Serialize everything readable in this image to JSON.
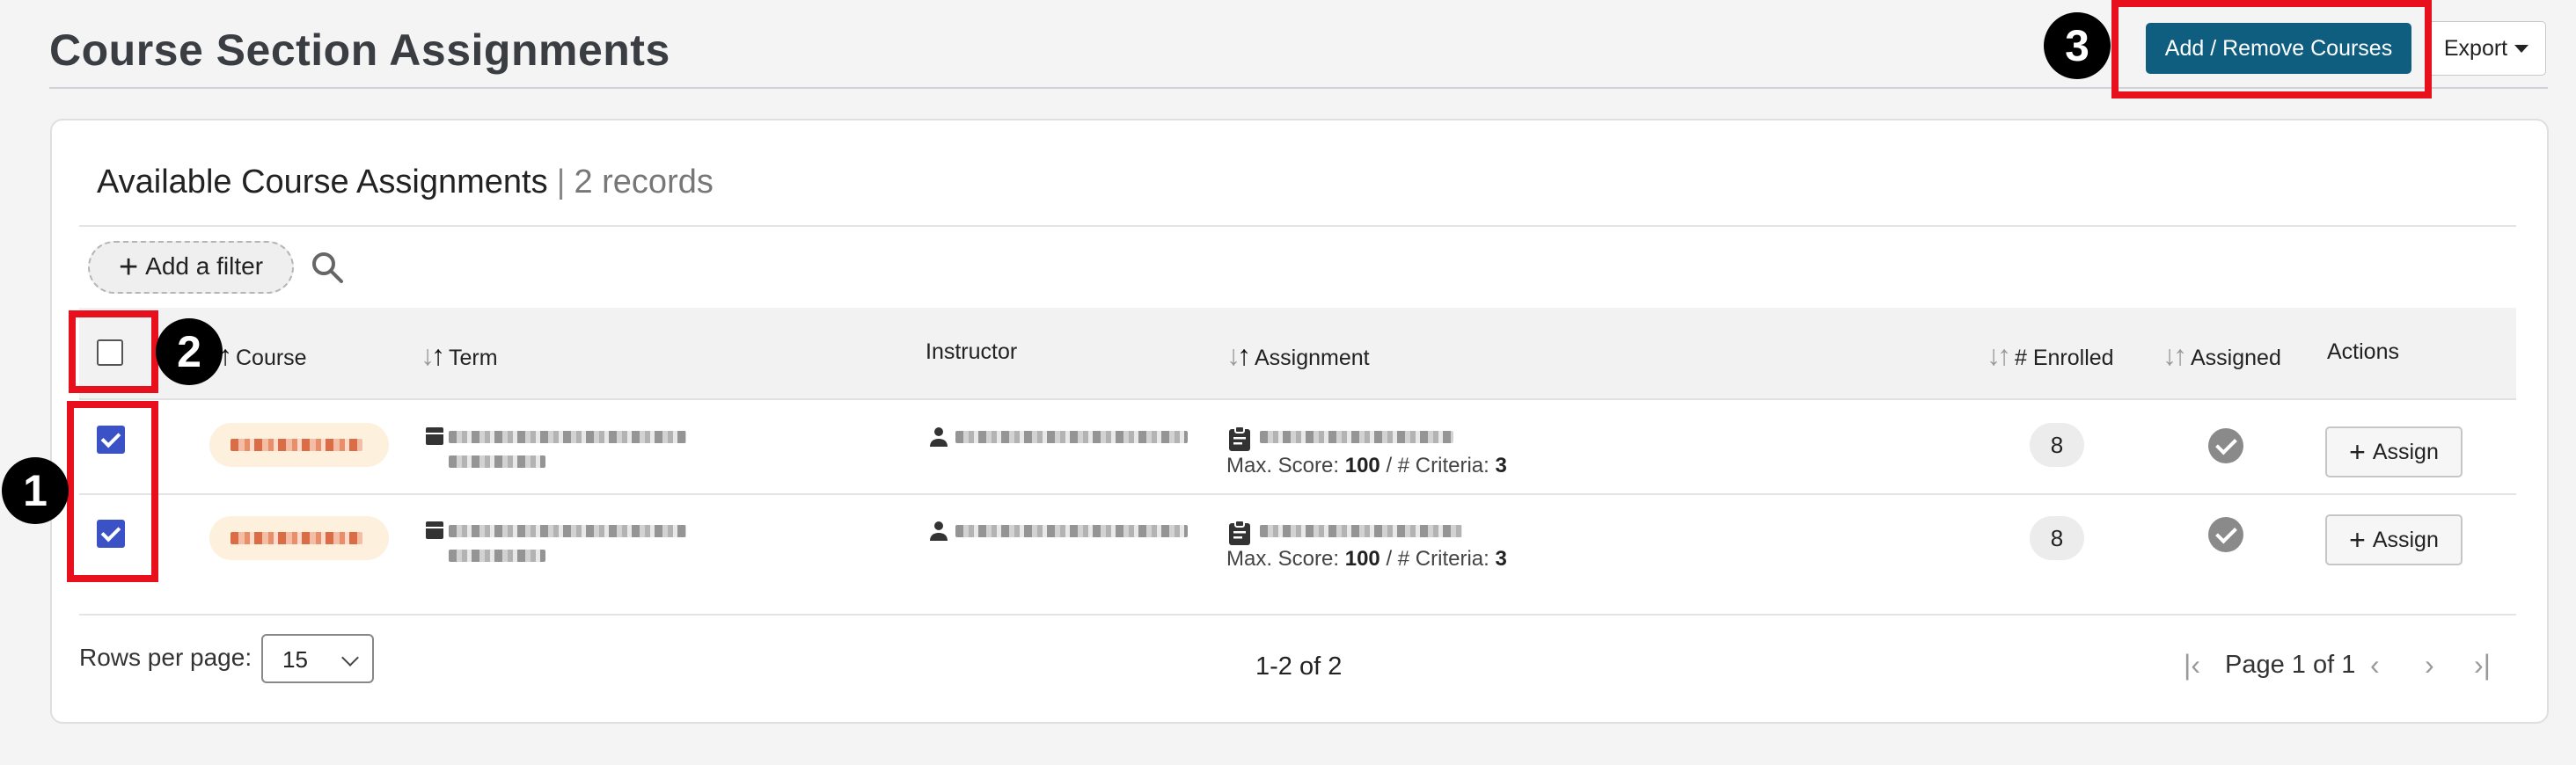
{
  "header": {
    "title": "Course Section Assignments",
    "add_remove_label": "Add / Remove Courses",
    "export_label": "Export"
  },
  "card": {
    "title": "Available Course Assignments",
    "separator": "|",
    "records": "2 records",
    "filter_label": "Add a filter"
  },
  "table": {
    "columns": {
      "course": "Course",
      "term": "Term",
      "instructor": "Instructor",
      "assignment": "Assignment",
      "enrolled": "# Enrolled",
      "assigned": "Assigned",
      "actions": "Actions"
    },
    "rows": [
      {
        "checked": true,
        "max_score_label": "Max. Score:",
        "max_score": "100",
        "criteria_label": "/ # Criteria:",
        "criteria": "3",
        "enrolled": "8",
        "assign_label": "Assign"
      },
      {
        "checked": true,
        "max_score_label": "Max. Score:",
        "max_score": "100",
        "criteria_label": "/ # Criteria:",
        "criteria": "3",
        "enrolled": "8",
        "assign_label": "Assign"
      }
    ]
  },
  "footer": {
    "rows_per_page_label": "Rows per page:",
    "rows_per_page_value": "15",
    "range": "1-2 of 2",
    "page_label": "Page 1 of 1"
  },
  "annotations": [
    "1",
    "2",
    "3"
  ],
  "colors": {
    "primary": "#0f5e80",
    "checkbox": "#3a52c6",
    "highlight": "#e8101c",
    "course_pill": "#fdf0dc"
  }
}
